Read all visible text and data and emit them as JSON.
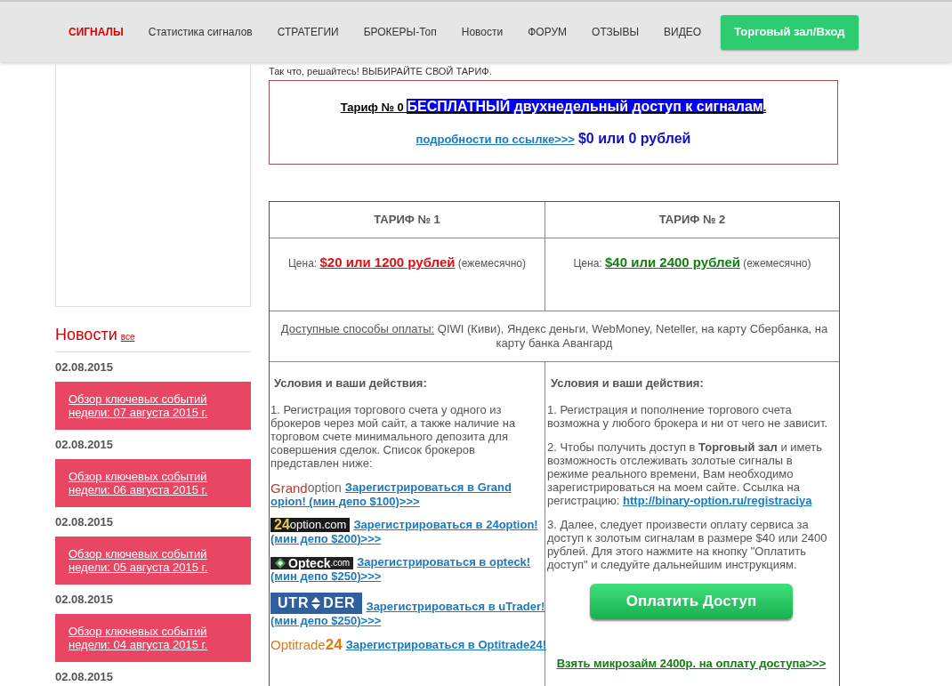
{
  "nav": {
    "items": [
      {
        "label": "СИГНАЛЫ",
        "selected": true
      },
      {
        "label": "Статистика сигналов",
        "selected": false
      },
      {
        "label": "СТРАТЕГИИ",
        "selected": false
      },
      {
        "label": "БРОКЕРЫ-Топ",
        "selected": false
      },
      {
        "label": "Новости",
        "selected": false
      },
      {
        "label": "ФОРУМ",
        "selected": false
      },
      {
        "label": "ОТЗЫВЫ",
        "selected": false
      },
      {
        "label": "ВИДЕО",
        "selected": false
      }
    ],
    "button": "Торговый зал/Вход"
  },
  "sidebar": {
    "news_title": "Новости",
    "news_all": "все",
    "news": [
      {
        "date": "02.08.2015",
        "title": "Обзор ключевых событий недели: 07 августа 2015 г."
      },
      {
        "date": "02.08.2015",
        "title": "Обзор ключевых событий недели: 06 августа 2015 г."
      },
      {
        "date": "02.08.2015",
        "title": "Обзор ключевых событий недели: 05 августа 2015 г."
      },
      {
        "date": "02.08.2015",
        "title": "Обзор ключевых событий недели: 04 августа 2015 г."
      }
    ],
    "last_date": "02.08.2015"
  },
  "intro": "Так что, решайтесь! ВЫБИРАЙТЕ СВОЙ ТАРИФ.",
  "free_tariff": {
    "label": "Тариф № 0",
    "highlight": "БЕСПЛАТНЫЙ двухнедельный доступ к сигналам",
    "end": ".",
    "details_link": "подробности по ссылке>>>",
    "price": "$0 или 0 рублей"
  },
  "table": {
    "columns": [
      "ТАРИФ № 1",
      "ТАРИФ № 2"
    ],
    "prices": [
      {
        "prefix": "Цена:",
        "price": "$20 или 1200 рублей",
        "suffix": "(ежемесячно)",
        "color": "#e01010"
      },
      {
        "prefix": "Цена:",
        "price": "$40 или 2400 рублей",
        "suffix": "(ежемесячно)",
        "color": "#12800f"
      }
    ],
    "payment_label": "Доступные способы оплаты:",
    "payment_text": "QIWI (Киви), Яндекс деньги, WebMoney, Neteller, на карту Сбербанка, на карту банка Авангард",
    "left": {
      "heading": "Условия и ваши действия:",
      "text": "1. Регистрация торгового счета у одного из брокеров через мой сайт, а также наличие на торговом счете минимального депозита для совершения сделок. Список брокеров представлен ниже:",
      "brokers": [
        {
          "logo": [
            "Grand",
            "option"
          ],
          "link": [
            "Зарегистрироваться в Grand",
            "opion! (мин депо $100)>>>"
          ]
        },
        {
          "logo": [
            "24",
            "option.com"
          ],
          "link": [
            "Зарегистрироваться в 24option!",
            "(мин депо $200)>>>"
          ]
        },
        {
          "logo": [
            "Opteck",
            ".com"
          ],
          "link": [
            "Зарегистрироваться в opteck!",
            "(мин депо $250)>>>"
          ]
        },
        {
          "logo": [
            "UTR",
            "DER"
          ],
          "link": [
            "Зарегистрироваться в uTrader!",
            "(мин депо $250)>>>"
          ]
        },
        {
          "logo": [
            "Optitrade",
            "24"
          ],
          "link": [
            "Зарегистрироваться в Optitrade24!"
          ]
        }
      ]
    },
    "right": {
      "heading": "Условия и ваши действия:",
      "paragraphs": [
        {
          "text": "1. Регистрация и пополнение торгового счета возможна у любого брокера и ни от чего не зависит."
        },
        {
          "text": "2. Чтобы получить доступ в **Торговый зал** и иметь возможность отслеживать золотые сигналы в режиме реального времени, Вам необходимо зарегистрироваться на моем сайте. Ссылка на регистрацию:",
          "link": "http://binary-option.ru/registraciya"
        },
        {
          "text": "3. Далее, следует произвести оплату сервиса за доступ к золотым сигналам в размере $40 или 2400 рублей. Для этого нажмите на кнопку \"Оплатить доступ\" и следуйте дальнейшим инструкциям."
        }
      ],
      "button": "Оплатить Доступ",
      "loan_link": "Взять микрозайм 2400р. на оплату доступа>>>"
    }
  }
}
